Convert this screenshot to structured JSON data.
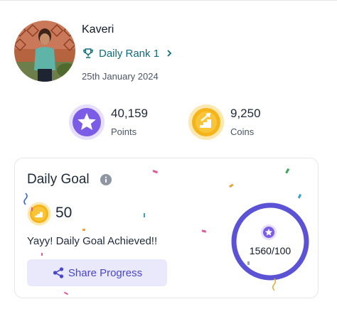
{
  "profile": {
    "name": "Kaveri",
    "rank_label": "Daily Rank 1",
    "date": "25th January 2024"
  },
  "stats": {
    "points": {
      "value": "40,159",
      "label": "Points"
    },
    "coins": {
      "value": "9,250",
      "label": "Coins"
    }
  },
  "daily_goal": {
    "title": "Daily Goal",
    "coins": "50",
    "achieved_text": "Yayy! Daily Goal Achieved!!",
    "share_label": "Share Progress",
    "progress_text": "1560/100"
  },
  "colors": {
    "accent_purple": "#6a5ae0",
    "rank_teal": "#0f6d7a",
    "coin_gold": "#f5b41a",
    "button_bg": "#e9e9fb"
  },
  "icons": [
    "trophy-icon",
    "chevron-right-icon",
    "star-icon",
    "coin-icon",
    "info-icon",
    "share-icon"
  ]
}
